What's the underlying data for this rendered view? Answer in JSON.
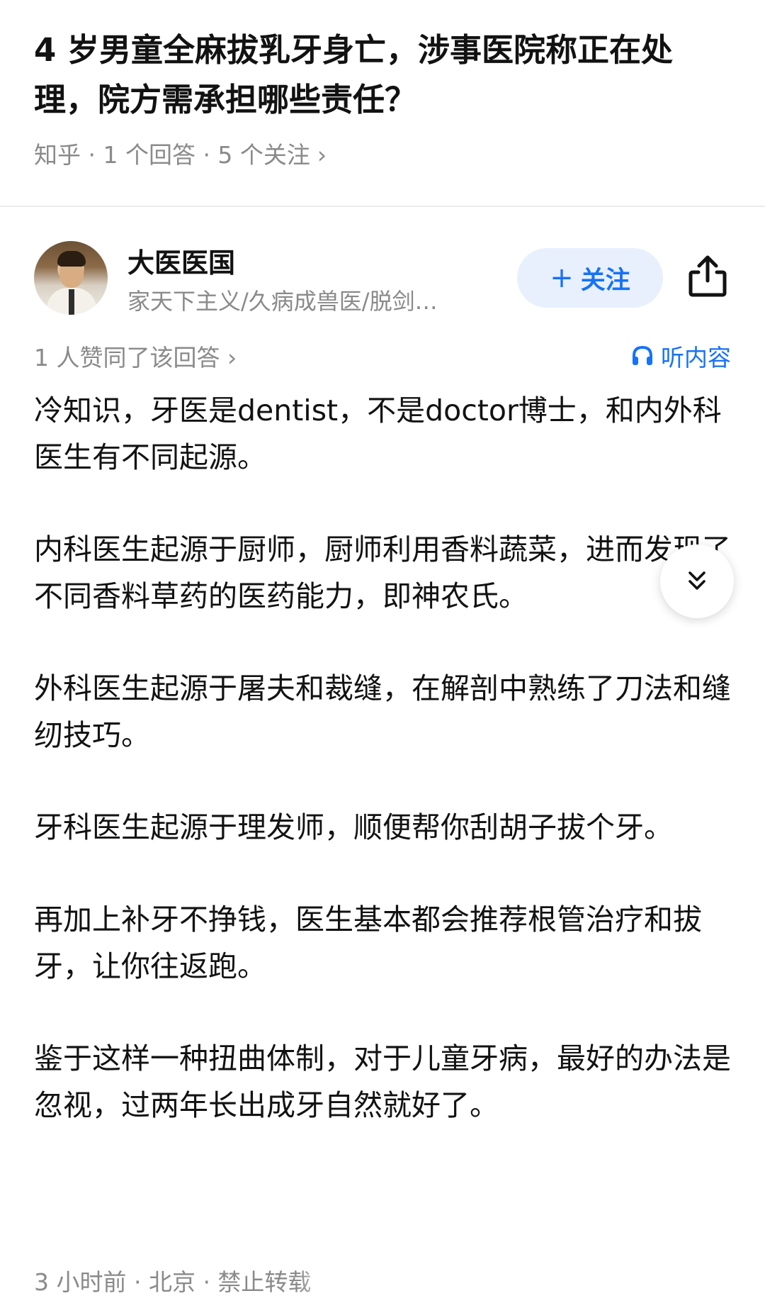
{
  "question": {
    "title": "4 岁男童全麻拔乳牙身亡，涉事医院称正在处理，院方需承担哪些责任？",
    "meta": "知乎 · 1 个回答 · 5 个关注",
    "meta_chevron": "›"
  },
  "author": {
    "name": "大医医国",
    "bio": "家天下主义/久病成兽医/脱剑…",
    "follow_label": "关注",
    "follow_plus": "+"
  },
  "answer": {
    "votes_text": "1 人赞同了该回答",
    "votes_chevron": "›",
    "listen_label": "听内容",
    "paragraphs": [
      "冷知识，牙医是dentist，不是doctor博士，和内外科医生有不同起源。",
      "内科医生起源于厨师，厨师利用香料蔬菜，进而发现了不同香料草药的医药能力，即神农氏。",
      "外科医生起源于屠夫和裁缝，在解剖中熟练了刀法和缝纫技巧。",
      "牙科医生起源于理发师，顺便帮你刮胡子拔个牙。",
      "再加上补牙不挣钱，医生基本都会推荐根管治疗和拔牙，让你往返跑。",
      "鉴于这样一种扭曲体制，对于儿童牙病，最好的办法是忽视，过两年长出成牙自然就好了。"
    ],
    "footer": "3 小时前 · 北京 · 禁止转载"
  },
  "colors": {
    "accent": "#1772f6",
    "muted": "#8a8a8a",
    "text": "#121212"
  },
  "icons": [
    "share-icon",
    "headphones-icon",
    "double-chevron-down-icon"
  ]
}
